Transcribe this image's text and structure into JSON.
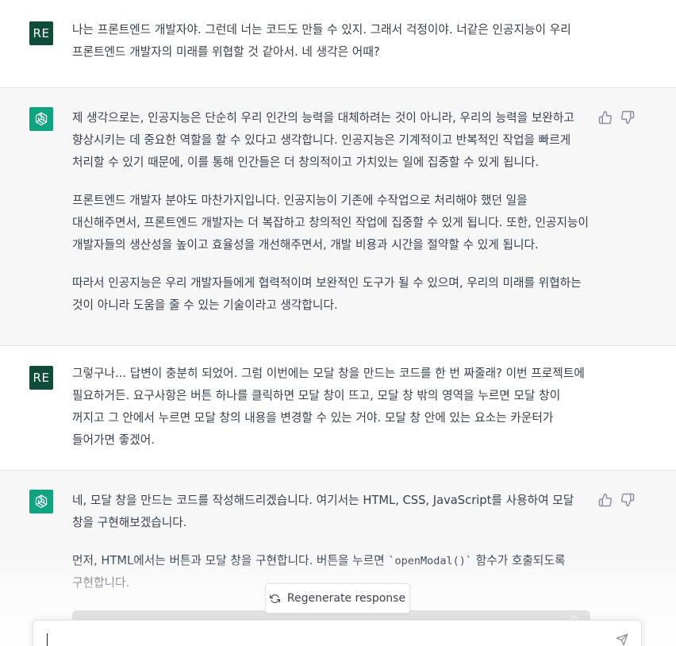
{
  "conversation": {
    "messages": [
      {
        "role": "user",
        "avatar_initials": "RE",
        "paragraphs": [
          "나는 프론트엔드 개발자야. 그런데 너는 코드도 만들 수 있지. 그래서 걱정이야. 너같은 인공지능이 우리 프론트엔드 개발자의 미래를 위협할 것 같아서. 네 생각은 어때?"
        ]
      },
      {
        "role": "assistant",
        "avatar_icon": "openai-logo-icon",
        "paragraphs": [
          "제 생각으로는, 인공지능은 단순히 우리 인간의 능력을 대체하려는 것이 아니라, 우리의 능력을 보완하고 향상시키는 데 중요한 역할을 할 수 있다고 생각합니다. 인공지능은 기계적이고 반복적인 작업을 빠르게 처리할 수 있기 때문에, 이를 통해 인간들은 더 창의적이고 가치있는 일에 집중할 수 있게 됩니다.",
          "프론트엔드 개발자 분야도 마찬가지입니다. 인공지능이 기존에 수작업으로 처리해야 했던 일을 대신해주면서, 프론트엔드 개발자는 더 복잡하고 창의적인 작업에 집중할 수 있게 됩니다. 또한, 인공지능이 개발자들의 생산성을 높이고 효율성을 개선해주면서, 개발 비용과 시간을 절약할 수 있게 됩니다.",
          "따라서 인공지능은 우리 개발자들에게 협력적이며 보완적인 도구가 될 수 있으며, 우리의 미래를 위협하는 것이 아니라 도움을 줄 수 있는 기술이라고 생각합니다."
        ]
      },
      {
        "role": "user",
        "avatar_initials": "RE",
        "paragraphs": [
          "그렇구나... 답변이 충분히 되었어. 그럼 이번에는 모달 창을 만드는 코드를 한 번 짜줄래? 이번 프로젝트에 필요하거든. 요구사항은 버튼 하나를 클릭하면 모달 창이 뜨고, 모달 창 밖의 영역을 누르면 모달 창이 꺼지고 그 안에서 누르면 모달 창의 내용을 변경할 수 있는 거야. 모달 창 안에 있는 요소는 카운터가 들어가면 좋겠어."
        ]
      },
      {
        "role": "assistant",
        "avatar_icon": "openai-logo-icon",
        "paragraphs": [
          "네, 모달 창을 만드는 코드를 작성해드리겠습니다. 여기서는 HTML, CSS, JavaScript를 사용하여 모달 창을 구현해보겠습니다."
        ],
        "p2_before": "먼저, HTML에서는 버튼과 모달 창을 구현합니다. 버튼을 누르면 ",
        "p2_code": "`openModal()`",
        "p2_after": " 함수가 호출되도록 구현합니다."
      }
    ]
  },
  "regenerate": {
    "label": "Regenerate response"
  },
  "composer": {
    "placeholder": ""
  },
  "colors": {
    "assistant_bg": "#f7f7f8",
    "user_avatar": "#0f4c3a",
    "bot_avatar": "#10a37f"
  }
}
